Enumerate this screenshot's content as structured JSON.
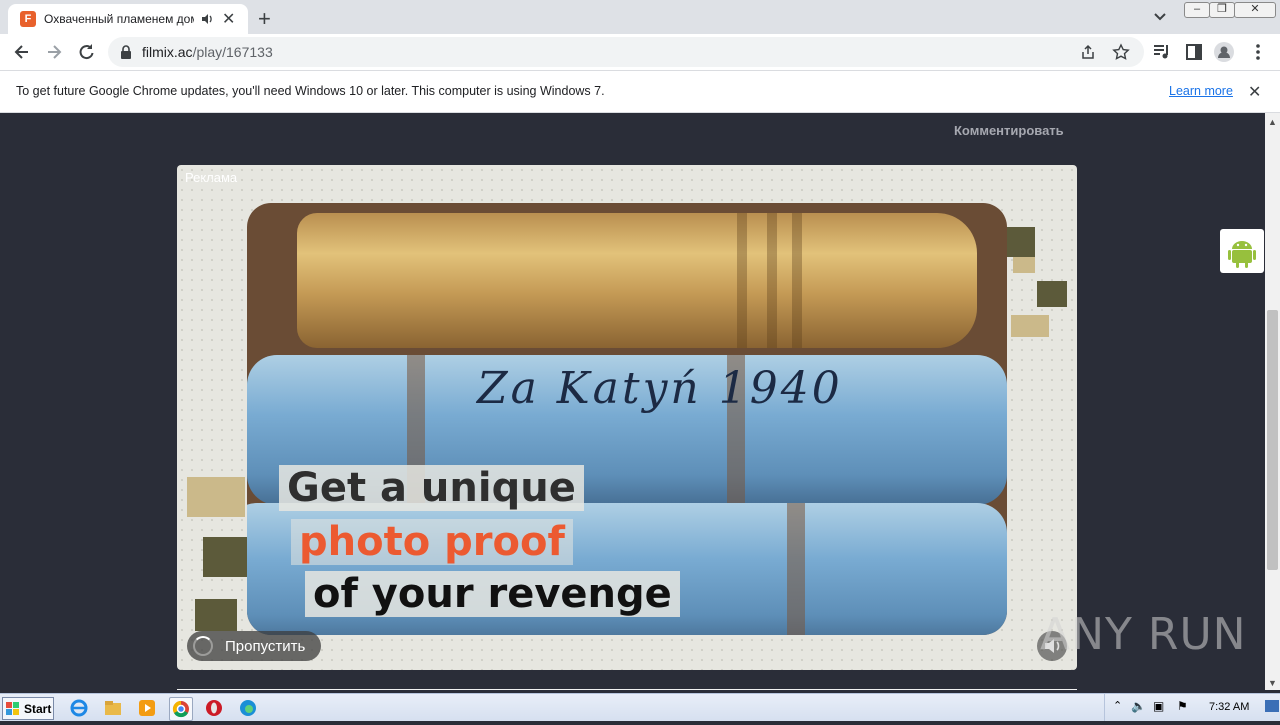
{
  "browser": {
    "tab": {
      "title": "Охваченный пламенем дом Ме",
      "favicon_letter": "F",
      "favicon_color": "#e8612c"
    },
    "window_controls": [
      "minimize",
      "restore",
      "close"
    ],
    "url": {
      "host": "filmix.ac",
      "path": "/play/167133"
    },
    "icons": [
      "back-icon",
      "forward-icon",
      "reload-icon",
      "lock-icon",
      "share-icon",
      "bookmark-star-icon",
      "media-control-icon",
      "side-panel-icon",
      "profile-icon",
      "menu-icon"
    ]
  },
  "infobar": {
    "message": "To get future Google Chrome updates, you'll need Windows 10 or later. This computer is using Windows 7.",
    "link": "Learn more"
  },
  "page": {
    "comment_link": "Комментировать",
    "ad": {
      "label": "Реклама",
      "handwriting": "Za Katyń 1940",
      "caption_line1": "Get a unique",
      "caption_line2": "photo proof",
      "caption_line3": "of your revenge",
      "caption_accent_color": "#ec5a31",
      "skip_label": "Пропустить"
    },
    "watermark": "ANY RUN"
  },
  "taskbar": {
    "start_label": "Start",
    "apps": [
      "ie-icon",
      "explorer-icon",
      "media-player-icon",
      "chrome-icon",
      "opera-icon",
      "edge-icon"
    ],
    "clock": "7:32 AM"
  }
}
